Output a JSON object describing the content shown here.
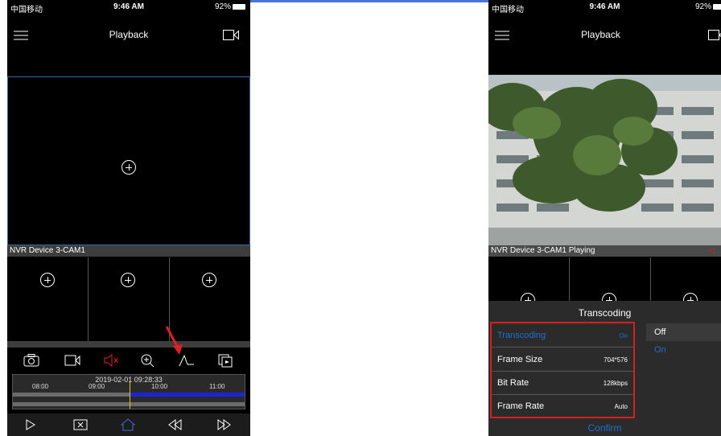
{
  "status": {
    "carrier": "中国移动",
    "time": "9:46 AM",
    "battery": "92%"
  },
  "left": {
    "nav_title": "Playback",
    "camera_label": "NVR Device 3-CAM1",
    "timeline": {
      "datetime": "2019-02-01 09:28:33",
      "ticks": [
        "08:00",
        "09:00",
        "10:00",
        "11:00"
      ]
    },
    "toolbar_icons": [
      "snapshot-icon",
      "record-icon",
      "speaker-icon",
      "zoom-icon",
      "transcoding-icon",
      "copy-icon"
    ],
    "bottom_icons": [
      "play-icon",
      "close-icon",
      "home-icon",
      "rewind-icon",
      "forward-icon"
    ]
  },
  "right": {
    "nav_title": "Playback",
    "camera_label": "NVR Device 3-CAM1 Playing",
    "dialog": {
      "title": "Transcoding",
      "rows": [
        {
          "label": "Transcoding",
          "value": "On"
        },
        {
          "label": "Frame Size",
          "value": "704*576"
        },
        {
          "label": "Bit Rate",
          "value": "128kbps"
        },
        {
          "label": "Frame Rate",
          "value": "Auto"
        }
      ],
      "options": [
        "Off",
        "On"
      ],
      "confirm": "Confirm"
    }
  },
  "colors": {
    "accent_blue": "#1e6fd0",
    "highlight_red": "#d42020",
    "timeline_blue": "#1a25d6"
  }
}
